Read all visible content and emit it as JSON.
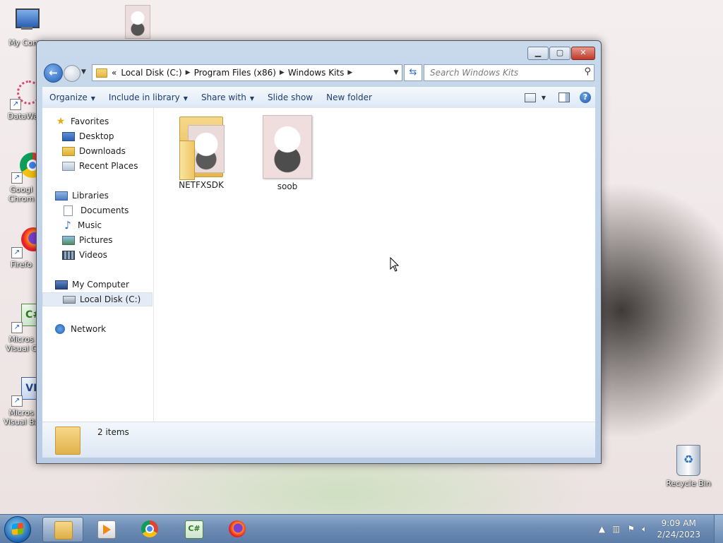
{
  "desktop": {
    "icons": [
      {
        "label": "My Comp",
        "glyph": "computer-icon"
      },
      {
        "label": "DataWag",
        "glyph": "datawag-icon"
      },
      {
        "label": "Googl Chrom",
        "glyph": "chrome-icon"
      },
      {
        "label": "Firefo",
        "glyph": "firefox-icon"
      },
      {
        "label": "Micros Visual C",
        "glyph": "visual-csharp-icon"
      },
      {
        "label": "Micros Visual Ba",
        "glyph": "visual-basic-icon"
      }
    ],
    "recycle_bin": "Recycle Bin"
  },
  "window": {
    "address": {
      "overflow": "«",
      "crumbs": [
        "Local Disk (C:)",
        "Program Files (x86)",
        "Windows Kits"
      ]
    },
    "search_placeholder": "Search Windows Kits",
    "toolbar": {
      "organize": "Organize",
      "include_in_library": "Include in library",
      "share_with": "Share with",
      "slide_show": "Slide show",
      "new_folder": "New folder"
    },
    "nav": {
      "favorites": "Favorites",
      "desktop": "Desktop",
      "downloads": "Downloads",
      "recent_places": "Recent Places",
      "libraries": "Libraries",
      "documents": "Documents",
      "music": "Music",
      "pictures": "Pictures",
      "videos": "Videos",
      "my_computer": "My Computer",
      "local_disk": "Local Disk (C:)",
      "network": "Network"
    },
    "files": [
      {
        "name": "NETFXSDK",
        "kind": "folder"
      },
      {
        "name": "soob",
        "kind": "image"
      }
    ],
    "status": "2 items"
  },
  "taskbar": {
    "time": "9:09 AM",
    "date": "2/24/2023",
    "apps": [
      "windows-explorer",
      "media-player",
      "google-chrome",
      "visual-csharp",
      "firefox"
    ]
  },
  "colors": {
    "accent": "#1d5fb7",
    "taskbar": "#6d8db5",
    "selection": "#e3ebf6",
    "close": "#c0392b"
  }
}
